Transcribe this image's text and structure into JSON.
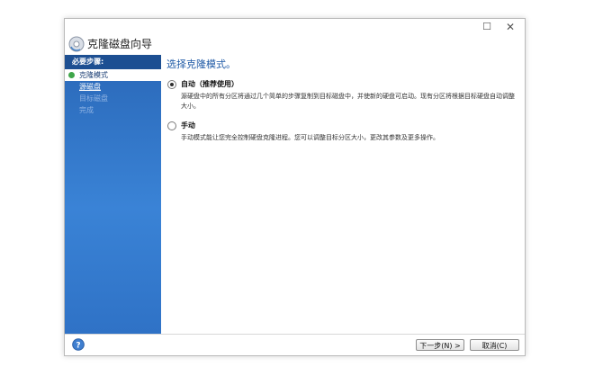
{
  "window": {
    "maximize_glyph": "☐",
    "close_glyph": "✕"
  },
  "wizard": {
    "title": "克隆磁盘向导",
    "icon": "disk-clone-icon"
  },
  "sidebar": {
    "header": "必要步骤:",
    "steps": [
      {
        "label": "克隆模式",
        "state": "active"
      },
      {
        "label": "源磁盘",
        "state": "link"
      },
      {
        "label": "目标磁盘",
        "state": "disabled"
      },
      {
        "label": "完成",
        "state": "disabled"
      }
    ]
  },
  "main": {
    "title": "选择克隆模式。",
    "options": [
      {
        "label": "自动（推荐使用）",
        "checked": true,
        "description": "源硬盘中的所有分区将通过几个简单的步骤复制到目标磁盘中，并使新的硬盘可启动。现有分区将根据目标硬盘自动调整大小。"
      },
      {
        "label": "手动",
        "checked": false,
        "description": "手动模式能让您完全控制硬盘克隆进程。您可以调整目标分区大小，更改其参数及更多操作。"
      }
    ]
  },
  "footer": {
    "next_label": "下一步(N) >",
    "cancel_label": "取消(C)",
    "help_icon": "help-icon"
  },
  "colors": {
    "sidebar_top": "#2a68b8",
    "sidebar_header": "#1d4f92",
    "title_blue": "#1f5aa6"
  }
}
